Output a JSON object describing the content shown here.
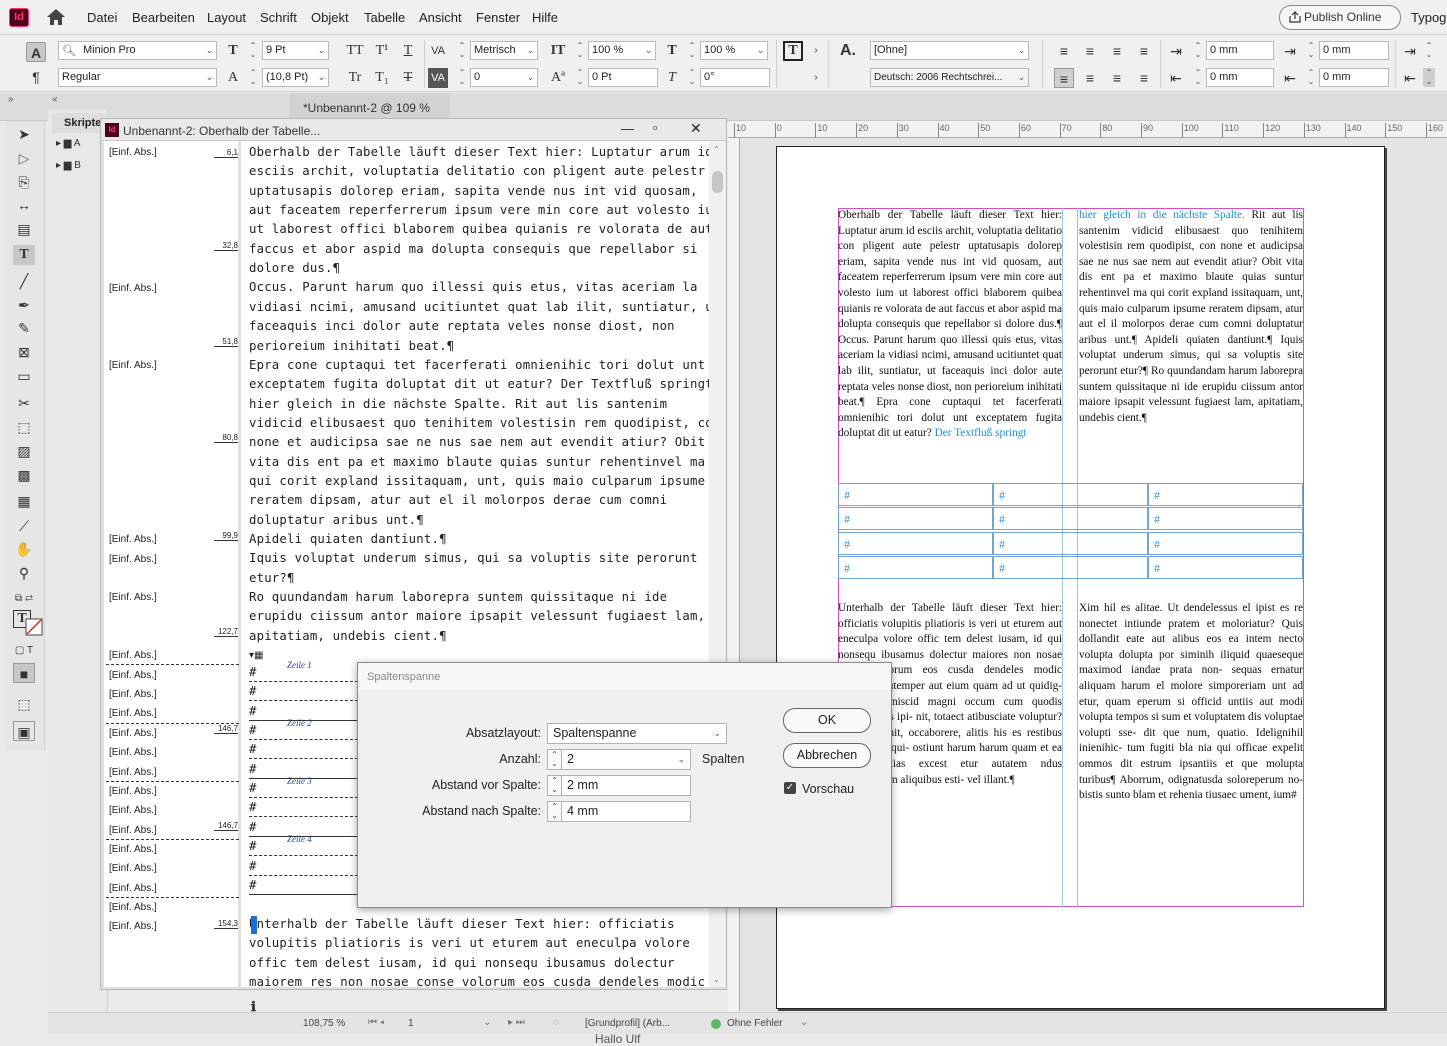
{
  "app": {
    "logo_text": "Id",
    "menu": [
      "Datei",
      "Bearbeiten",
      "Layout",
      "Schrift",
      "Objekt",
      "Tabelle",
      "Ansicht",
      "Fenster",
      "Hilfe"
    ],
    "publish_label": "Publish Online",
    "workspace_label": "Typogr"
  },
  "control": {
    "font_family": "Minion Pro",
    "font_style": "Regular",
    "font_size": "9 Pt",
    "leading": "(10,8 Pt)",
    "kerning": "Metrisch",
    "tracking": "0",
    "vscale": "100 %",
    "hscale": "100 %",
    "baseline": "0 Pt",
    "skew": "0°",
    "char_style": "[Ohne]",
    "language": "Deutsch: 2006 Rechtschrei...",
    "indent_left": "0 mm",
    "indent_right": "0 mm",
    "first_line": "0 mm",
    "last_line": "0 mm",
    "abbrev_1": "TT",
    "abbrev_2": "Tr"
  },
  "tabs": {
    "document_tab": "*Unbenannt-2 @ 109 %",
    "close": "✕"
  },
  "scripts_panel": {
    "title": "Skripte",
    "items": [
      "A",
      "B"
    ]
  },
  "story_editor": {
    "title": "Unbenannt-2: Oberhalb der Tabelle...",
    "styles": [
      "[Einf. Abs.]",
      "[Einf. Abs.]",
      "[Einf. Abs.]",
      "[Einf. Abs.]",
      "[Einf. Abs.]",
      "[Einf. Abs.]",
      "[Einf. Abs.]",
      "[Einf. Abs.]",
      "[Einf. Abs.]",
      "[Einf. Abs.]",
      "[Einf. Abs.]",
      "[Einf. Abs.]",
      "[Einf. Abs.]",
      "[Einf. Abs.]",
      "[Einf. Abs.]",
      "[Einf. Abs.]",
      "[Einf. Abs.]",
      "[Einf. Abs.]",
      "[Einf. Abs.]",
      "[Einf. Abs.]",
      "[Einf. Abs.]"
    ],
    "depths": [
      "6,1",
      "32,8",
      "51,8",
      "80,8",
      "99,9",
      "122,7",
      "146,7",
      "146,7",
      "154,3"
    ],
    "lines": [
      "Oberhalb der Tabelle läuft dieser Text hier: Luptatur arum id",
      "esciis archit, voluptatia delitatio con pligent aute pelestr",
      "uptatusapis dolorep eriam, sapita vende nus int vid quosam,",
      "aut faceatem reperferrerum ipsum vere min core aut volesto ium",
      "ut laborest offici blaborem quibea quianis re volorata de aut",
      "faccus et abor aspid ma dolupta consequis que repellabor si",
      "dolore dus.¶",
      "Occus. Parunt harum quo illessi quis etus, vitas aceriam la",
      "vidiasi ncimi, amusand ucitiuntet quat lab ilit, suntiatur, ut",
      "faceaquis inci dolor aute reptata veles nonse diost, non",
      "perioreium inihitati beat.¶",
      "Epra cone cuptaqui tet facerferati omnienihic tori dolut unt",
      "exceptatem fugita doluptat dit ut eatur? Der Textfluß springt",
      "hier gleich in die nächste Spalte. Rit aut lis santenim",
      "vidi​cid elibusaest quo tenihitem volestisin rem quodipist, con",
      "none et audicipsa sae ne nus sae nem aut evendit atiur? Obit",
      "vita dis ent pa et maximo blaute quias suntur rehentinvel ma",
      "qui corit expland issitaquam, unt, quis maio culparum ipsume",
      "reratem dipsam, atur aut el il molorpos derae cum comni",
      "doluptatur aribus unt.¶",
      "Apideli quiaten dantiunt.¶",
      "Iquis voluptat underum simus, qui sa voluptis site perorunt",
      "etur?¶",
      "Ro quundandam harum laborepra suntem quissitaque ni ide",
      "erupidu ciissum antor maiore ipsapit velessunt fugiaest lam,",
      "apitatiam, undebis cient.¶"
    ],
    "table_rows": [
      "Zeile 1",
      "Zeile 2",
      "Zeile 3",
      "Zeile 4"
    ],
    "cell_marker": "#",
    "after_lines": [
      "Unterhalb der Tabelle läuft dieser Text hier: officiatis",
      "volupitis pliatioris is veri ut eturem aut eneculpa volore",
      "offic tem delest iusam, id qui nonsequ ibusamus dolectur",
      "maiorem res non nosae conse volorum eos cusda dendeles modic"
    ]
  },
  "ruler": {
    "marks": [
      "10",
      "0",
      "10",
      "20",
      "30",
      "40",
      "50",
      "60",
      "70",
      "80",
      "90",
      "100",
      "110",
      "120",
      "130",
      "140",
      "150",
      "160"
    ]
  },
  "page": {
    "col1_top": "Oberhalb der Tabelle läuft dieser Text hier: Luptatur arum id esciis archit, voluptatia delitatio con pligent aute pelestr uptatusapis dolorep eriam, sapita vende nus int vid quosam, aut faceatem reperferrerum ipsum vere min core aut volesto ium ut laborest offici blaborem quibea quianis re volorata de aut faccus et abor aspid ma dolupta consequis que repellabor si dolore dus.¶ Occus. Parunt harum quo illessi quis etus, vitas aceriam la vidiasi ncimi, amusand ucitiuntet quat lab ilit, suntiatur, ut faceaquis inci dolor aute reptata veles nonse diost, non perioreium inihitati beat.¶ Epra cone cuptaqui tet facerferati omnienihic tori dolut unt exceptatem fugita doluptat dit ut eatur?",
    "col1_blue": " Der Textfluß springt",
    "col2_blue": "hier gleich in die nächste Spalte.",
    "col2_top": " Rit aut lis santenim vidicid elibusaest quo tenihitem volestisin rem quodipist, con none et audicipsa sae ne nus sae nem aut evendit atiur? Obit vita dis ent pa et maximo blaute quias suntur rehentinvel ma qui corit expland issitaquam, unt, quis maio culparum ipsume reratem dipsam, atur aut el il molorpos derae cum comni doluptatur aribus unt.¶ Apideli quiaten dantiunt.¶ Iquis voluptat underum simus, qui sa voluptis site perorunt etur?¶ Ro quundandam harum laborepra suntem quissitaque ni ide erupidu ciissum antor maiore ipsapit velessunt fugiaest lam, apitatiam, undebis cient.¶",
    "col1_bottom": "Unterhalb der Tabelle läuft dieser Text hier: officiatis volupitis pliatioris is veri ut eturem aut eneculpa volore offic tem delest iusam, id qui nonsequ ibusamus dolectur maiores non nosae conse volorum eos cusda dendeles modic temporem utemper aut eium quam ad ut quidig- dignihic teniscid magni occum cum quodis dusandandis ipi- nit, totaect atibusciate voluptur? rum, te venit, occaborere, alitis his es restibus iniendenda qui- ostiunt harum harum quam et ea tiatium litias excest etur autatem ndus dellendignim aliquibus esti- vel illant.¶",
    "col2_bottom": "Xim hil es alitae. Ut dendelessus el ipist es re nonectet intiunde pratem et moloriatur? Quis dollandit eate aut alibus eos ea intem necto volupta dolupta por siminih iliquid quaeseque maximod iandae prata non- sequas ernatur aliquam harum el molore simporeriam unt ad etur, quam eperum si officid untiis aut modi volupta tempos si sum et voluptatem dis voluptae volupti sse- dit que num, quatio. Idelignihil inienihic- tum fugiti bla nia qui officae expelit ommos dit estrum ipsantiis et que molupta turibus¶ Aborrum, odignatusda soloreperum no- bistis sunto blam et rehenia tiusaec ument, ium#"
  },
  "status": {
    "zoom": "108,75 %",
    "page_num": "1",
    "profile": "[Grundprofil] (Arb...",
    "errors": "Ohne Fehler",
    "bottom_text": "Hallo Ulf"
  },
  "dialog": {
    "title": "Spaltenspanne",
    "layout_label": "Absatzlayout:",
    "layout_value": "Spaltenspanne",
    "count_label": "Anzahl:",
    "count_value": "2",
    "count_unit": "Spalten",
    "before_label": "Abstand vor Spalte:",
    "before_value": "2 mm",
    "after_label": "Abstand nach Spalte:",
    "after_value": "4 mm",
    "ok": "OK",
    "cancel": "Abbrechen",
    "preview": "Vorschau",
    "preview_checked": true
  },
  "colors": {
    "accent_blue": "#1a8fd6",
    "table_line": "#6fa6d6",
    "frame_magenta": "#d050c0"
  }
}
